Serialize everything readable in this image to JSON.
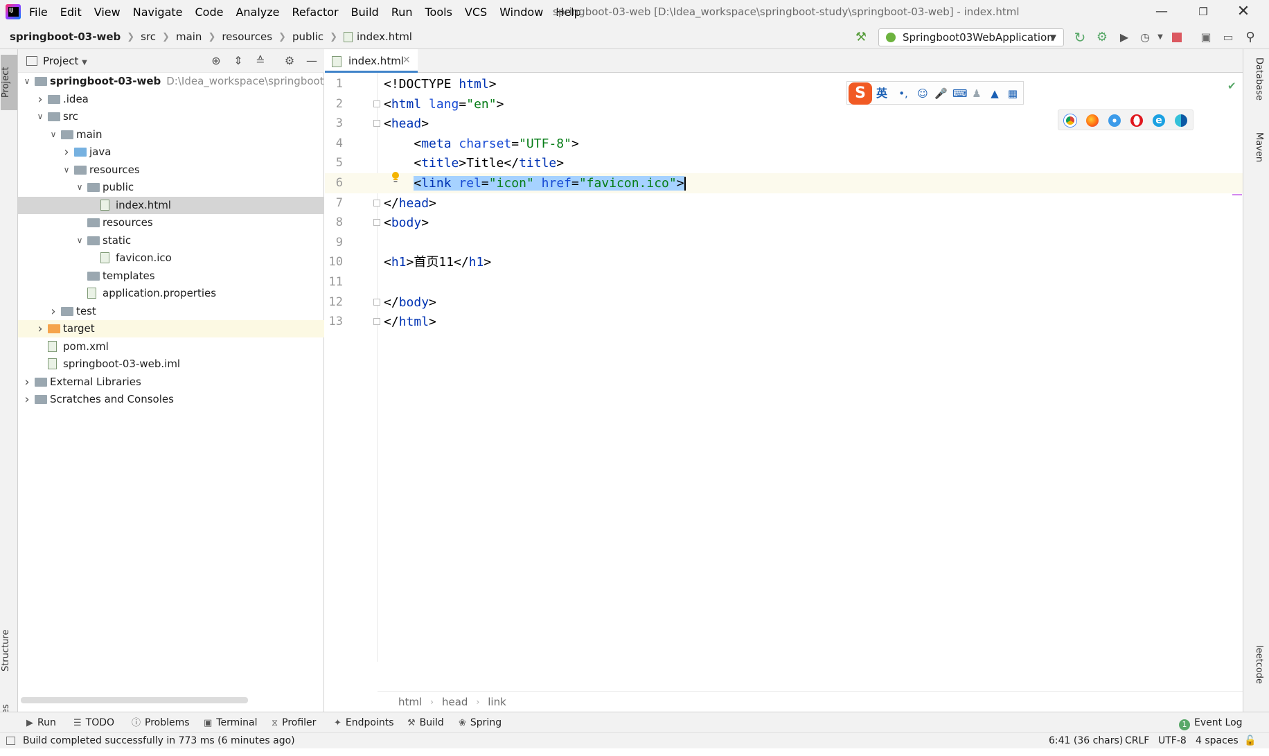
{
  "app": {
    "window_title": "springboot-03-web [D:\\Idea_workspace\\springboot-study\\springboot-03-web] - index.html",
    "menus": [
      "File",
      "Edit",
      "View",
      "Navigate",
      "Code",
      "Analyze",
      "Refactor",
      "Build",
      "Run",
      "Tools",
      "VCS",
      "Window",
      "Help"
    ]
  },
  "breadcrumb": [
    "springboot-03-web",
    "src",
    "main",
    "resources",
    "public",
    "index.html"
  ],
  "run_config": "Springboot03WebApplication",
  "left_tools": {
    "project": "Project",
    "structure": "Structure",
    "favorites": "Favorites"
  },
  "right_tools": {
    "database": "Database",
    "maven": "Maven",
    "leetcode": "leetcode"
  },
  "project_panel": {
    "title": "Project",
    "tree": [
      {
        "label": "springboot-03-web",
        "path": "D:\\Idea_workspace\\springboot-study",
        "depth": 0,
        "expanded": true,
        "kind": "module",
        "bold": true
      },
      {
        "label": ".idea",
        "depth": 1,
        "expanded": false,
        "kind": "folder"
      },
      {
        "label": "src",
        "depth": 1,
        "expanded": true,
        "kind": "folder"
      },
      {
        "label": "main",
        "depth": 2,
        "expanded": true,
        "kind": "folder"
      },
      {
        "label": "java",
        "depth": 3,
        "expanded": false,
        "kind": "folder-blue"
      },
      {
        "label": "resources",
        "depth": 3,
        "expanded": true,
        "kind": "folder-res"
      },
      {
        "label": "public",
        "depth": 4,
        "expanded": true,
        "kind": "folder"
      },
      {
        "label": "index.html",
        "depth": 5,
        "kind": "file",
        "selected": true
      },
      {
        "label": "resources",
        "depth": 4,
        "kind": "folder"
      },
      {
        "label": "static",
        "depth": 4,
        "expanded": true,
        "kind": "folder"
      },
      {
        "label": "favicon.ico",
        "depth": 5,
        "kind": "file"
      },
      {
        "label": "templates",
        "depth": 4,
        "kind": "folder"
      },
      {
        "label": "application.properties",
        "depth": 4,
        "kind": "file"
      },
      {
        "label": "test",
        "depth": 2,
        "expanded": false,
        "kind": "folder"
      },
      {
        "label": "target",
        "depth": 1,
        "expanded": false,
        "kind": "folder-orange",
        "highlight": true
      },
      {
        "label": "pom.xml",
        "depth": 1,
        "kind": "file"
      },
      {
        "label": "springboot-03-web.iml",
        "depth": 1,
        "kind": "file"
      },
      {
        "label": "External Libraries",
        "depth": 0,
        "expanded": false,
        "kind": "library"
      },
      {
        "label": "Scratches and Consoles",
        "depth": 0,
        "expanded": false,
        "kind": "scratch"
      }
    ]
  },
  "editor": {
    "tab_label": "index.html",
    "current_line": 6,
    "lines": [
      {
        "n": "1",
        "text": "<!DOCTYPE html>"
      },
      {
        "n": "2",
        "text": "<html lang=\"en\">"
      },
      {
        "n": "3",
        "text": "<head>"
      },
      {
        "n": "4",
        "text": "    <meta charset=\"UTF-8\">"
      },
      {
        "n": "5",
        "text": "    <title>Title</title>"
      },
      {
        "n": "6",
        "text": "    <link rel=\"icon\" href=\"favicon.ico\">"
      },
      {
        "n": "7",
        "text": "</head>"
      },
      {
        "n": "8",
        "text": "<body>"
      },
      {
        "n": "9",
        "text": ""
      },
      {
        "n": "10",
        "text": "<h1>首页11</h1>"
      },
      {
        "n": "11",
        "text": ""
      },
      {
        "n": "12",
        "text": "</body>"
      },
      {
        "n": "13",
        "text": "</html>"
      }
    ],
    "code_breadcrumb": [
      "html",
      "head",
      "link"
    ]
  },
  "ime": {
    "logo": "S",
    "lang": "英"
  },
  "bottom_tools": [
    "Run",
    "TODO",
    "Problems",
    "Terminal",
    "Profiler",
    "Endpoints",
    "Build",
    "Spring"
  ],
  "event_log": {
    "label": "Event Log",
    "count": "1"
  },
  "status": {
    "message": "Build completed successfully in 773 ms (6 minutes ago)",
    "position": "6:41 (36 chars)",
    "line_sep": "CRLF",
    "encoding": "UTF-8",
    "indent": "4 spaces"
  },
  "colors": {
    "accent": "#4083c9",
    "selection": "#a6d2ff",
    "tag": "#0033b3",
    "attr_value": "#067d17",
    "success": "#59a869"
  }
}
